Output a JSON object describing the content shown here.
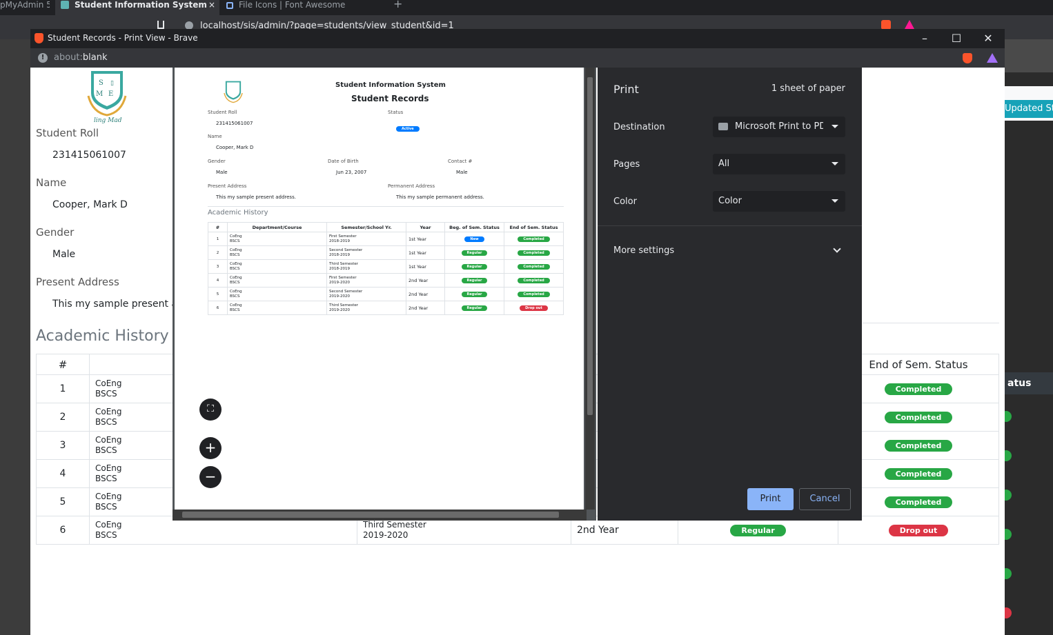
{
  "bg_browser": {
    "tabs": [
      {
        "label": "pMyAdmin 5"
      },
      {
        "label": "Student Information System",
        "close": "×"
      },
      {
        "label": "File Icons | Font Awesome"
      }
    ],
    "new_tab": "+",
    "url": "localhost/sis/admin/?page=students/view_student&id=1",
    "right_button": "Updated Status",
    "right_header": "atus"
  },
  "window": {
    "title": "Student Records - Print View - Brave",
    "address_scheme": "about:",
    "address_path": "blank",
    "controls": {
      "minimize": "–",
      "maximize": "☐",
      "close": "✕"
    }
  },
  "page": {
    "logo_letters": [
      "S",
      "M",
      "E"
    ],
    "logo_tagline": "ling Mad",
    "fields": {
      "student_roll_label": "Student Roll",
      "student_roll": "231415061007",
      "name_label": "Name",
      "name": "Cooper, Mark D",
      "gender_label": "Gender",
      "gender": "Male",
      "present_address_label": "Present Address",
      "present_address": "This my sample present ad"
    },
    "academic_heading": "Academic History",
    "table": {
      "headers": {
        "num": "#",
        "end_status": "End of Sem. Status"
      },
      "rows": [
        {
          "num": "1",
          "dept": "CoEng",
          "course": "BSCS",
          "end_status": "Completed",
          "end_color": "#28a745"
        },
        {
          "num": "2",
          "dept": "CoEng",
          "course": "BSCS",
          "end_status": "Completed",
          "end_color": "#28a745"
        },
        {
          "num": "3",
          "dept": "CoEng",
          "course": "BSCS",
          "end_status": "Completed",
          "end_color": "#28a745"
        },
        {
          "num": "4",
          "dept": "CoEng",
          "course": "BSCS",
          "end_status": "Completed",
          "end_color": "#28a745"
        },
        {
          "num": "5",
          "dept": "CoEng",
          "course": "BSCS",
          "end_status": "Completed",
          "end_color": "#28a745"
        },
        {
          "num": "6",
          "dept": "CoEng",
          "course": "BSCS",
          "semester": "Third Semester",
          "school_year": "2019-2020",
          "year": "2nd Year",
          "beg_status": "Regular",
          "end_status": "Drop out",
          "end_color": "#dc3545"
        }
      ]
    }
  },
  "print_dialog": {
    "title": "Print",
    "sheets": "1 sheet of paper",
    "destination_label": "Destination",
    "destination_value": "Microsoft Print to PDF",
    "pages_label": "Pages",
    "pages_value": "All",
    "color_label": "Color",
    "color_value": "Color",
    "more_settings": "More settings",
    "print_button": "Print",
    "cancel_button": "Cancel",
    "zoom": {
      "fit": "⛶",
      "in": "+",
      "out": "−"
    }
  },
  "preview": {
    "system_title": "Student Information System",
    "doc_title": "Student Records",
    "student_roll_label": "Student Roll",
    "student_roll": "231415061007",
    "status_label": "Status",
    "status": "Active",
    "name_label": "Name",
    "name": "Cooper, Mark D",
    "gender_label": "Gender",
    "gender": "Male",
    "dob_label": "Date of Birth",
    "dob": "Jun 23, 2007",
    "contact_label": "Contact #",
    "contact": "Male",
    "present_address_label": "Present Address",
    "present_address": "This my sample present address.",
    "permanent_address_label": "Permanent Address",
    "permanent_address": "This my sample permanent address.",
    "academic_heading": "Academic History",
    "table": {
      "headers": [
        "#",
        "Department/Course",
        "Semester/School Yr.",
        "Year",
        "Beg. of Sem. Status",
        "End of Sem. Status"
      ],
      "rows": [
        {
          "num": "1",
          "dept": "CoEng",
          "course": "BSCS",
          "semester": "First Semester",
          "sy": "2018-2019",
          "year": "1st Year",
          "beg": "New",
          "beg_color": "#007bff",
          "end": "Completed",
          "end_color": "#28a745"
        },
        {
          "num": "2",
          "dept": "CoEng",
          "course": "BSCS",
          "semester": "Second Semester",
          "sy": "2018-2019",
          "year": "1st Year",
          "beg": "Regular",
          "beg_color": "#28a745",
          "end": "Completed",
          "end_color": "#28a745"
        },
        {
          "num": "3",
          "dept": "CoEng",
          "course": "BSCS",
          "semester": "Third Semester",
          "sy": "2018-2019",
          "year": "1st Year",
          "beg": "Regular",
          "beg_color": "#28a745",
          "end": "Completed",
          "end_color": "#28a745"
        },
        {
          "num": "4",
          "dept": "CoEng",
          "course": "BSCS",
          "semester": "First Semester",
          "sy": "2019-2020",
          "year": "2nd Year",
          "beg": "Regular",
          "beg_color": "#28a745",
          "end": "Completed",
          "end_color": "#28a745"
        },
        {
          "num": "5",
          "dept": "CoEng",
          "course": "BSCS",
          "semester": "Second Semester",
          "sy": "2019-2020",
          "year": "2nd Year",
          "beg": "Regular",
          "beg_color": "#28a745",
          "end": "Completed",
          "end_color": "#28a745"
        },
        {
          "num": "6",
          "dept": "CoEng",
          "course": "BSCS",
          "semester": "Third Semester",
          "sy": "2019-2020",
          "year": "2nd Year",
          "beg": "Regular",
          "beg_color": "#28a745",
          "end": "Drop out",
          "end_color": "#dc3545"
        }
      ]
    }
  }
}
